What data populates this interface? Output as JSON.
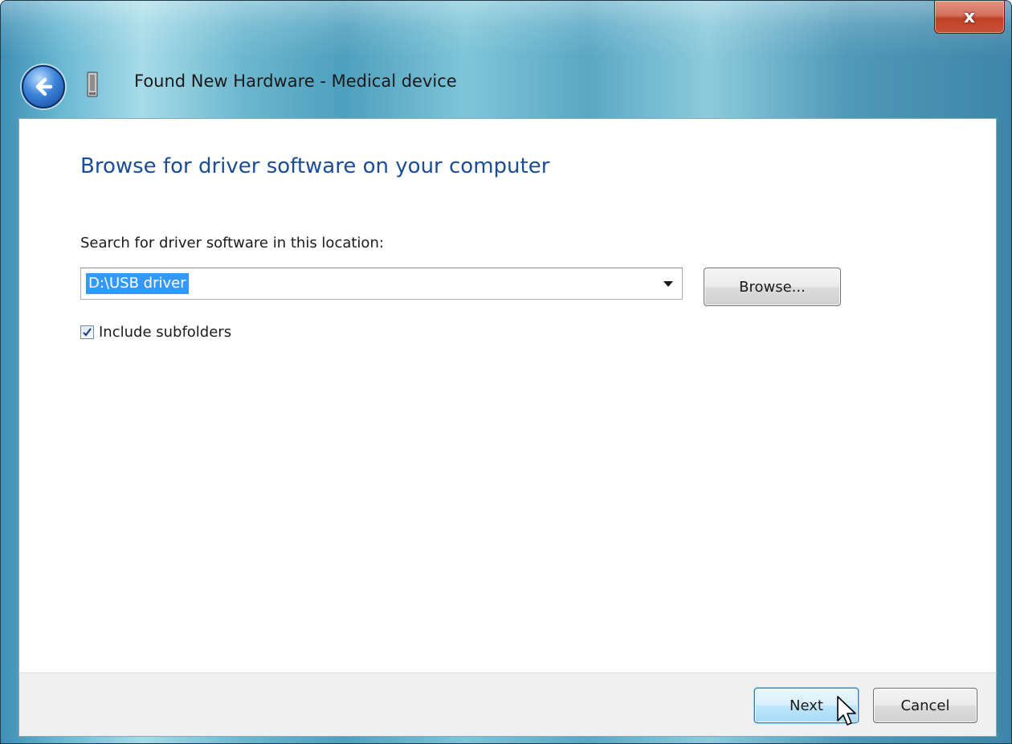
{
  "window": {
    "title": "Found New Hardware - Medical device",
    "close_label": "x"
  },
  "content": {
    "heading": "Browse for driver software on your computer",
    "search_label": "Search for driver software in this location:",
    "location": {
      "value": "D:\\USB driver",
      "selected": true
    },
    "browse_label": "Browse...",
    "include_subfolders": {
      "label": "Include subfolders",
      "checked": true
    }
  },
  "footer": {
    "next_label": "Next",
    "cancel_label": "Cancel"
  },
  "icons": {
    "back": "back-arrow-icon",
    "device": "hardware-device-icon",
    "dropdown": "chevron-down-icon",
    "check": "checkmark-icon",
    "cursor": "mouse-pointer-icon"
  },
  "colors": {
    "heading": "#1b4c96",
    "selection": "#3399ff",
    "frame": "#5aa7c4",
    "close": "#c5533a",
    "default_button_border": "#3c7fb1"
  }
}
